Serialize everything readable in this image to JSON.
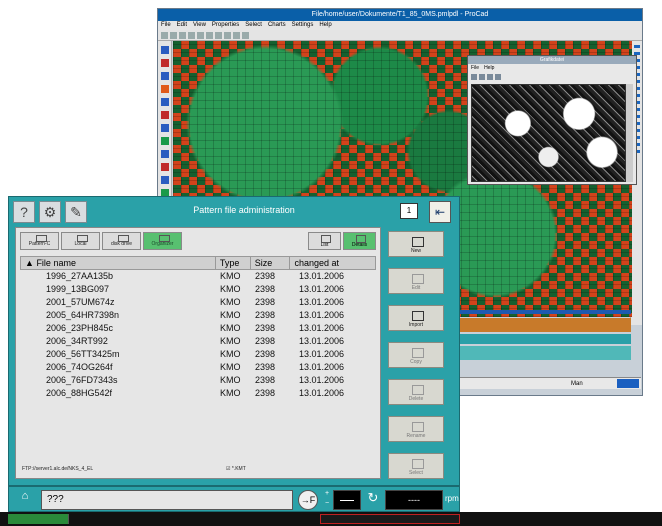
{
  "dialog": {
    "title": "Pattern file administration",
    "badge": "1",
    "help_icon": "?",
    "exit_icon": "⇤",
    "tabs": [
      {
        "label": "Pattern-C",
        "active": false
      },
      {
        "label": "Local",
        "active": false
      },
      {
        "label": "disk drive",
        "active": false
      },
      {
        "label": "Organizer",
        "active": true
      }
    ],
    "views": [
      {
        "label": "List",
        "active": false
      },
      {
        "label": "Details",
        "active": true
      }
    ],
    "columns": [
      "File name",
      "Type",
      "Size",
      "changed at"
    ],
    "sort_indicator": "▲",
    "rows": [
      [
        "1996_27AA135b",
        "KMO",
        "2398",
        "13.01.2006"
      ],
      [
        "1999_13BG097",
        "KMO",
        "2398",
        "13.01.2006"
      ],
      [
        "2001_57UM674z",
        "KMO",
        "2398",
        "13.01.2006"
      ],
      [
        "2005_64HR7398n",
        "KMO",
        "2398",
        "13.01.2006"
      ],
      [
        "2006_23PH845c",
        "KMO",
        "2398",
        "13.01.2006"
      ],
      [
        "2006_34RT992",
        "KMO",
        "2398",
        "13.01.2006"
      ],
      [
        "2006_56TT3425m",
        "KMO",
        "2398",
        "13.01.2006"
      ],
      [
        "2006_74OG264f",
        "KMO",
        "2398",
        "13.01.2006"
      ],
      [
        "2006_76FD7343s",
        "KMO",
        "2398",
        "13.01.2006"
      ],
      [
        "2006_88HG542f",
        "KMO",
        "2398",
        "13.01.2006"
      ]
    ],
    "path": "FTP://server1.alc.de/NKS_4_EL",
    "filter": "☑ *.KMT",
    "side_buttons": [
      {
        "label": "New",
        "enabled": true
      },
      {
        "label": "Edit",
        "enabled": false
      },
      {
        "label": "Import",
        "enabled": true
      },
      {
        "label": "Copy",
        "enabled": false
      },
      {
        "label": "Delete",
        "enabled": false
      },
      {
        "label": "Rename",
        "enabled": false
      },
      {
        "label": "Select",
        "enabled": false
      }
    ]
  },
  "statusbar": {
    "message": "???",
    "f_button": "→F",
    "rpm_value": "----",
    "rpm_unit": "rpm"
  },
  "cad_window": {
    "title": "File/home/user/Dokumente/T1_85_0MS.pmlpdl - ProCad",
    "menu": [
      "File",
      "Edit",
      "View",
      "Properties",
      "Select",
      "Charts",
      "Settings",
      "Help"
    ],
    "status_right": "Man"
  },
  "preview_window": {
    "title": "Grafikdatei",
    "menu": [
      "File",
      "Help"
    ]
  }
}
